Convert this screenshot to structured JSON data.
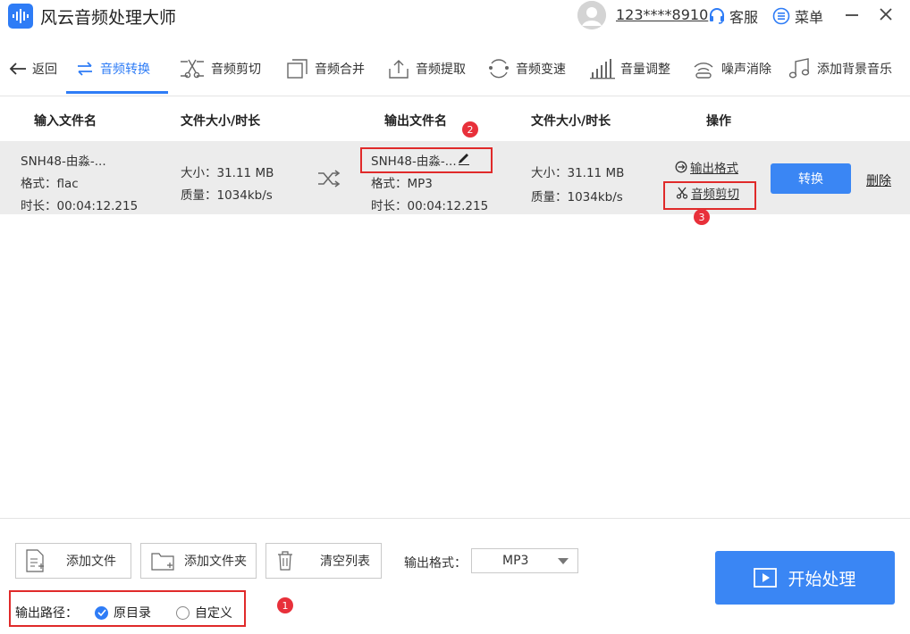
{
  "app": {
    "title": "风云音频处理大师"
  },
  "header": {
    "user_phone": "123****8910",
    "service_label": "客服",
    "menu_label": "菜单"
  },
  "toolbar": {
    "back_label": "返回",
    "items": [
      {
        "label": "音频转换",
        "icon": "convert-arrows-icon",
        "active": true
      },
      {
        "label": "音频剪切",
        "icon": "audio-cut-icon",
        "active": false
      },
      {
        "label": "音频合并",
        "icon": "merge-icon",
        "active": false
      },
      {
        "label": "音频提取",
        "icon": "extract-icon",
        "active": false
      },
      {
        "label": "音频变速",
        "icon": "speed-icon",
        "active": false
      },
      {
        "label": "音量调整",
        "icon": "volume-bars-icon",
        "active": false
      },
      {
        "label": "噪声消除",
        "icon": "noise-wave-icon",
        "active": false
      },
      {
        "label": "添加背景音乐",
        "icon": "music-note-icon",
        "active": false
      }
    ],
    "accent_color": "#2e7cf6"
  },
  "table": {
    "headers": [
      "输入文件名",
      "文件大小/时长",
      "输出文件名",
      "文件大小/时长",
      "操作"
    ],
    "rows": [
      {
        "input_name": "SNH48-由淼-...",
        "input_format": "格式：flac",
        "input_duration": "时长：00:04:12.215",
        "input_size": "大小：31.11 MB",
        "input_quality": "质量：1034kb/s",
        "output_name": "SNH48-由淼-...",
        "output_format": "格式：MP3",
        "output_duration": "时长：00:04:12.215",
        "output_size": "大小：31.11 MB",
        "output_quality": "质量：1034kb/s",
        "op_output_format": "输出格式",
        "op_audio_cut": "音频剪切",
        "convert_label": "转换",
        "delete_label": "删除"
      }
    ]
  },
  "bottom": {
    "add_file_label": "添加文件",
    "add_folder_label": "添加文件夹",
    "clear_list_label": "清空列表",
    "output_format_label": "输出格式：",
    "output_format_value": "MP3",
    "start_label": "开始处理",
    "output_path_label": "输出路径：",
    "path_options": [
      {
        "label": "原目录",
        "checked": true
      },
      {
        "label": "自定义",
        "checked": false
      }
    ]
  },
  "annotations": {
    "markers": [
      "1",
      "2",
      "3"
    ],
    "color": "#e02a2a"
  }
}
